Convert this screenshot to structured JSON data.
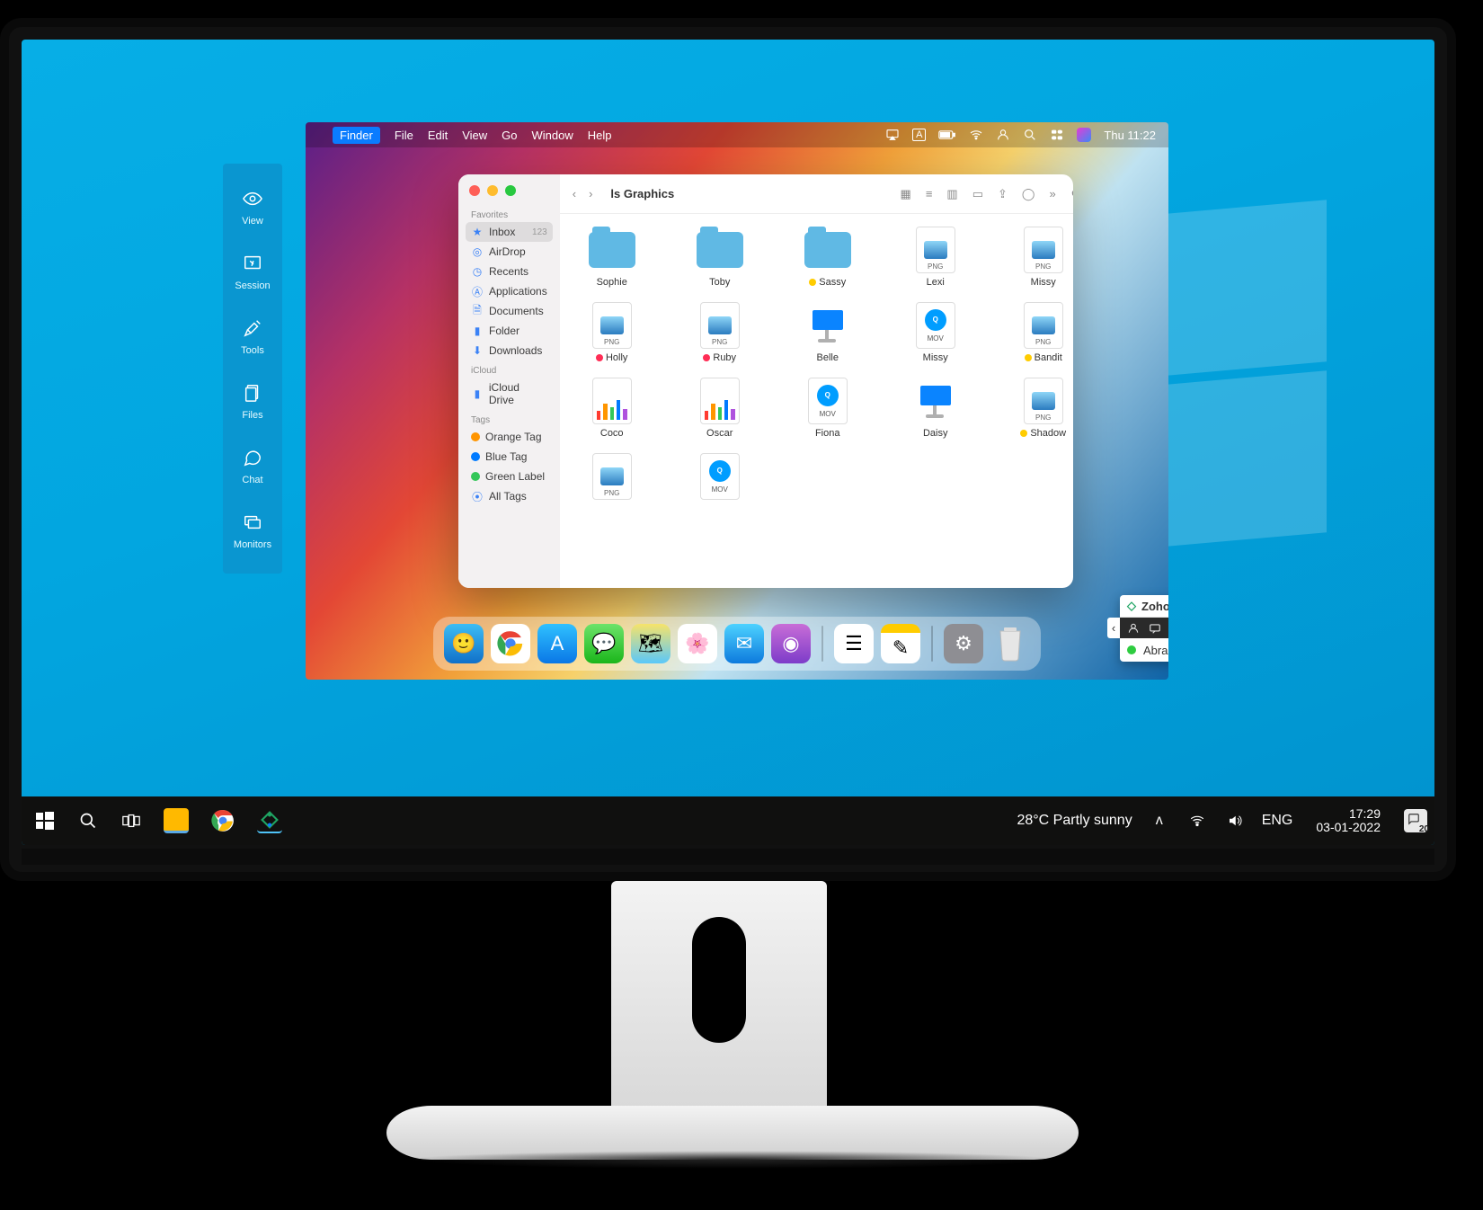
{
  "windows_taskbar": {
    "weather": "28°C  Partly sunny",
    "lang": "ENG",
    "time": "17:29",
    "date": "03-01-2022",
    "badge_count": "20"
  },
  "zoho_panel": {
    "items": [
      {
        "label": "View"
      },
      {
        "label": "Session"
      },
      {
        "label": "Tools"
      },
      {
        "label": "Files"
      },
      {
        "label": "Chat"
      },
      {
        "label": "Monitors"
      }
    ]
  },
  "zoho_widget": {
    "title": "Zoho Assist",
    "user": "Abraham"
  },
  "mac_menubar": {
    "app": "Finder",
    "items": [
      "File",
      "Edit",
      "View",
      "Go",
      "Window",
      "Help"
    ],
    "clock": "Thu 11:22"
  },
  "finder": {
    "title": "ls Graphics",
    "sidebar": {
      "favorites_label": "Favorites",
      "favorites": [
        {
          "label": "Inbox",
          "count": "123",
          "star": true,
          "active": true
        },
        {
          "label": "AirDrop"
        },
        {
          "label": "Recents"
        },
        {
          "label": "Applications"
        },
        {
          "label": "Documents"
        },
        {
          "label": "Folder"
        },
        {
          "label": "Downloads"
        }
      ],
      "icloud_label": "iCloud",
      "icloud": [
        {
          "label": "iCloud Drive"
        }
      ],
      "tags_label": "Tags",
      "tags": [
        {
          "label": "Orange Tag",
          "color": "#ff9500"
        },
        {
          "label": "Blue Tag",
          "color": "#007aff"
        },
        {
          "label": "Green Label",
          "color": "#34c759"
        },
        {
          "label": "All Tags",
          "all": true
        }
      ]
    },
    "grid": {
      "row1": [
        {
          "name": "Sophie",
          "type": "folder"
        },
        {
          "name": "Toby",
          "type": "folder"
        },
        {
          "name": "Sassy",
          "type": "folder",
          "tag": "#ffcc00"
        },
        {
          "name": "Lexi",
          "type": "png"
        },
        {
          "name": "Missy",
          "type": "png"
        }
      ],
      "row2": [
        {
          "name": "Holly",
          "type": "png",
          "tag": "#ff2d55"
        },
        {
          "name": "Ruby",
          "type": "png",
          "tag": "#ff2d55"
        },
        {
          "name": "Belle",
          "type": "keynote"
        },
        {
          "name": "Missy",
          "type": "mov"
        },
        {
          "name": "Bandit",
          "type": "png",
          "tag": "#ffcc00"
        }
      ],
      "row3": [
        {
          "name": "Coco",
          "type": "chart"
        },
        {
          "name": "Oscar",
          "type": "chart"
        },
        {
          "name": "Fiona",
          "type": "mov"
        },
        {
          "name": "Daisy",
          "type": "keynote"
        },
        {
          "name": "Shadow",
          "type": "png",
          "tag": "#ffcc00"
        }
      ],
      "row4": [
        {
          "name": "",
          "type": "png"
        },
        {
          "name": "",
          "type": "mov"
        }
      ]
    }
  }
}
